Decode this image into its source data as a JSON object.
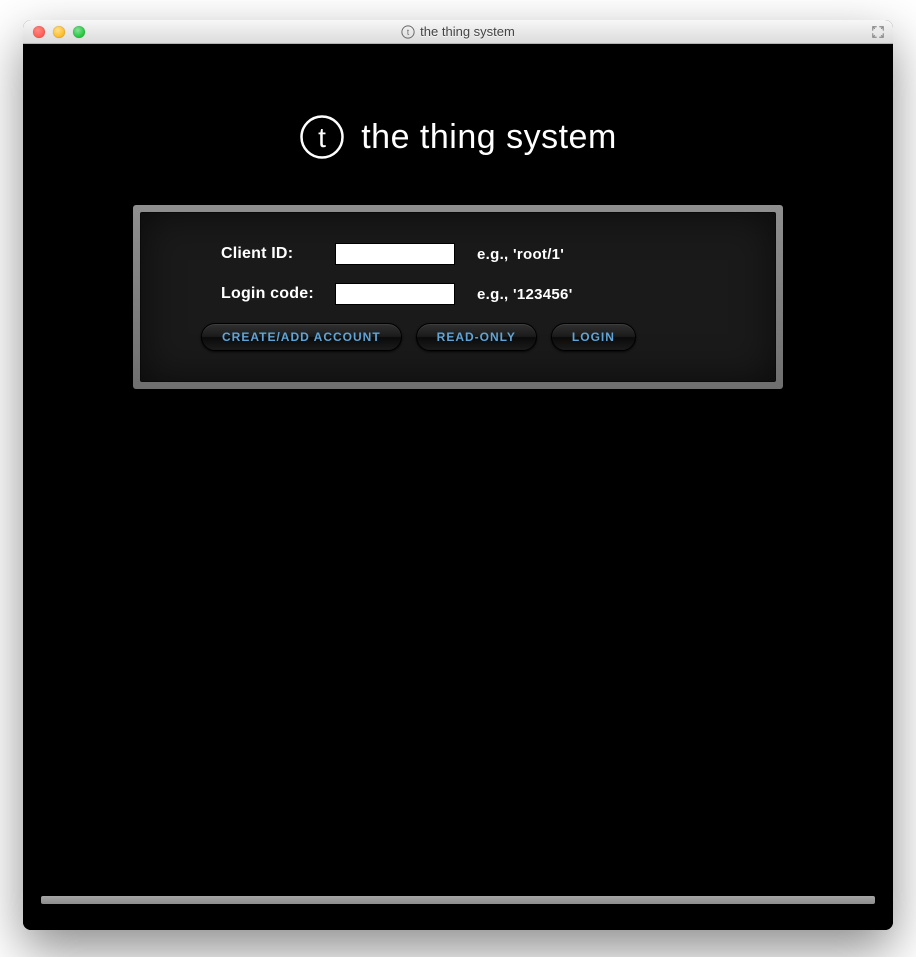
{
  "window": {
    "title": "the thing system",
    "title_icon": "t-circle-icon"
  },
  "brand": {
    "logo_letter": "t",
    "text": "the thing system"
  },
  "form": {
    "client_id": {
      "label": "Client ID:",
      "value": "",
      "hint": "e.g., 'root/1'"
    },
    "login_code": {
      "label": "Login code:",
      "value": "",
      "hint": "e.g., '123456'"
    }
  },
  "buttons": {
    "create": "CREATE/ADD ACCOUNT",
    "readonly": "READ-ONLY",
    "login": "LOGIN"
  },
  "colors": {
    "button_text": "#5fa4d6",
    "panel_bg": "#1a1a1a"
  }
}
